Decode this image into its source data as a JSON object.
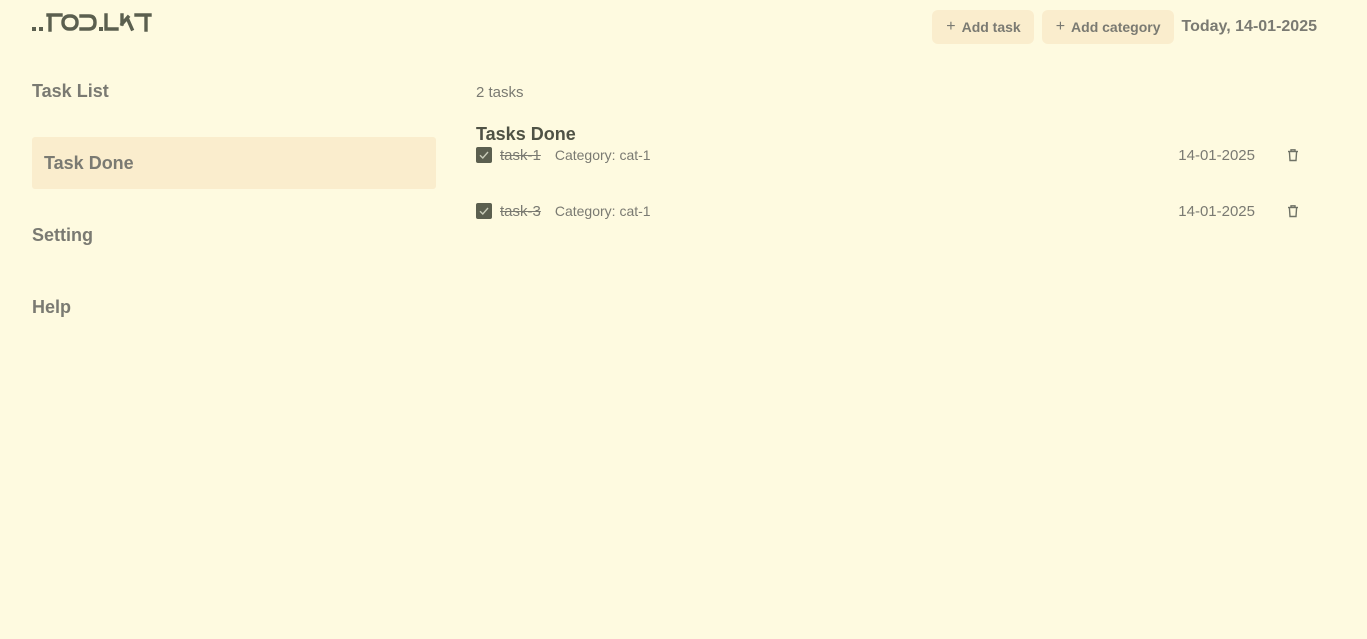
{
  "header": {
    "logo_text": "..TOD.LIST",
    "add_task_label": "Add task",
    "add_category_label": "Add category",
    "today": "Today, 14-01-2025"
  },
  "sidebar": {
    "items": [
      {
        "label": "Task List",
        "active": false
      },
      {
        "label": "Task Done",
        "active": true
      },
      {
        "label": "Setting",
        "active": false
      },
      {
        "label": "Help",
        "active": false
      }
    ]
  },
  "main": {
    "count": "2 tasks",
    "section_title": "Tasks Done",
    "tasks": [
      {
        "name": "task-1",
        "category": "Category: cat-1",
        "date": "14-01-2025",
        "done": true
      },
      {
        "name": "task-3",
        "category": "Category: cat-1",
        "date": "14-01-2025",
        "done": true
      }
    ]
  },
  "colors": {
    "background": "#fefae0",
    "accent": "#faedcd",
    "text": "#7a7a72",
    "dark": "#5b5f4f"
  },
  "icons": {
    "add": "plus-icon",
    "check": "check-icon",
    "delete": "trash-icon"
  }
}
